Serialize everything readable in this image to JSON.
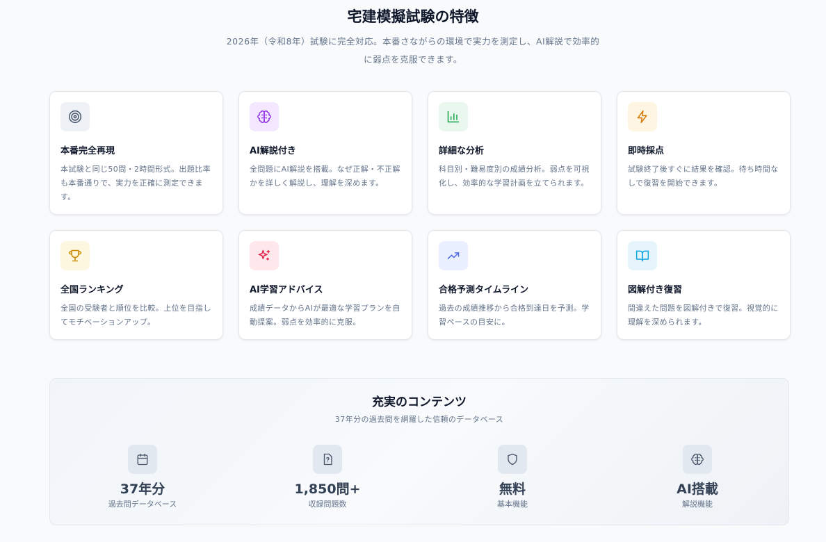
{
  "header": {
    "title": "宅建模擬試験の特徴",
    "subtitle_line1": "2026年（令和8年）試験に完全対応。本番さながらの環境で実力を測定し、AI解説で効率的",
    "subtitle_line2": "に弱点を克服できます。"
  },
  "features": [
    {
      "icon": "target-icon",
      "title": "本番完全再現",
      "desc": "本試験と同じ50問・2時間形式。出題比率も本番通りで、実力を正確に測定できます。",
      "bg": "#eef1f5",
      "color": "#475569"
    },
    {
      "icon": "brain-icon",
      "title": "AI解説付き",
      "desc": "全問題にAI解説を搭載。なぜ正解・不正解かを詳しく解説し、理解を深めます。",
      "bg": "#f3e8ff",
      "color": "#9333ea"
    },
    {
      "icon": "bar-chart-icon",
      "title": "詳細な分析",
      "desc": "科目別・難易度別の成績分析。弱点を可視化し、効率的な学習計画を立てられます。",
      "bg": "#e9f7ef",
      "color": "#16a34a"
    },
    {
      "icon": "zap-icon",
      "title": "即時採点",
      "desc": "試験終了後すぐに結果を確認。待ち時間なしで復習を開始できます。",
      "bg": "#fef5e2",
      "color": "#d97706"
    },
    {
      "icon": "trophy-icon",
      "title": "全国ランキング",
      "desc": "全国の受験者と順位を比較。上位を目指してモチベーションアップ。",
      "bg": "#fef7e0",
      "color": "#ca8a04"
    },
    {
      "icon": "sparkles-icon",
      "title": "AI学習アドバイス",
      "desc": "成績データからAIが最適な学習プランを自動提案。弱点を効率的に克服。",
      "bg": "#ffe8eb",
      "color": "#e11d48"
    },
    {
      "icon": "trending-up-icon",
      "title": "合格予測タイムライン",
      "desc": "過去の成績推移から合格到達日を予測。学習ペースの目安に。",
      "bg": "#eaf0ff",
      "color": "#4f6bed"
    },
    {
      "icon": "book-open-icon",
      "title": "図解付き復習",
      "desc": "間違えた問題を図解付きで復習。視覚的に理解を深められます。",
      "bg": "#e6f5fb",
      "color": "#0ea5e9"
    }
  ],
  "contents": {
    "title": "充実のコンテンツ",
    "subtitle": "37年分の過去問を網羅した信頼のデータベース",
    "stats": [
      {
        "icon": "calendar-icon",
        "value": "37年分",
        "label": "過去問データベース"
      },
      {
        "icon": "question-file-icon",
        "value": "1,850問+",
        "label": "収録問題数"
      },
      {
        "icon": "shield-icon",
        "value": "無料",
        "label": "基本機能"
      },
      {
        "icon": "brain-icon",
        "value": "AI搭載",
        "label": "解説機能"
      }
    ]
  }
}
